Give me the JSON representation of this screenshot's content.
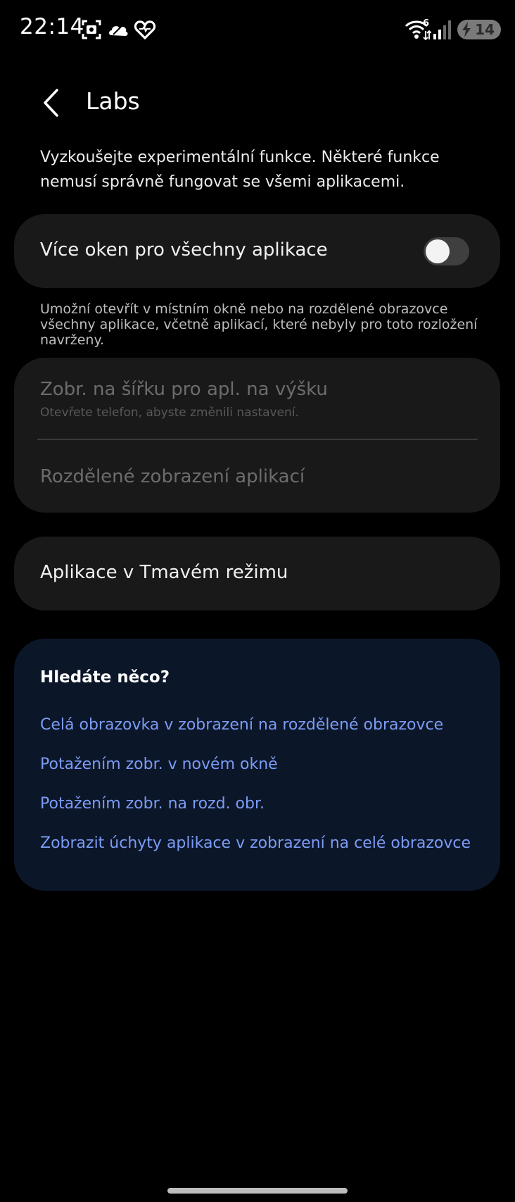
{
  "status_bar": {
    "time": "22:14",
    "network_badge": "6",
    "battery": "14",
    "icons": [
      "screenshot-icon",
      "weather-cloud-icon",
      "heart-health-icon",
      "wifi-icon",
      "signal-icon",
      "battery-charging-icon"
    ]
  },
  "header": {
    "back_icon": "chevron-left-icon",
    "title": "Labs"
  },
  "intro": "Vyzkoušejte experimentální funkce. Některé funkce nemusí správně fungovat se všemi aplikacemi.",
  "multi_window": {
    "label": "Více oken pro všechny aplikace",
    "toggle_on": false,
    "help": "Umožní otevřít v místním okně nebo na rozdělené obrazovce všechny aplikace, včetně aplikací, které nebyly pro toto rozložení navrženy."
  },
  "disabled_group": {
    "landscape_label": "Zobr. na šířku pro apl. na výšku",
    "landscape_sub": "Otevřete telefon, abyste změnili nastavení.",
    "split_label": "Rozdělené zobrazení aplikací"
  },
  "dark_mode": {
    "label": "Aplikace v Tmavém režimu"
  },
  "search_suggestions": {
    "heading": "Hledáte něco?",
    "links": [
      "Celá obrazovka v zobrazení na rozdělené obrazovce",
      "Potažením zobr. v novém okně",
      "Potažením zobr. na rozd. obr.",
      "Zobrazit úchyty aplikace v zobrazení na celé obrazovce"
    ]
  },
  "colors": {
    "background": "#000000",
    "card": "#191919",
    "suggestion_card": "#0c1629",
    "link": "#7b9cf4"
  }
}
